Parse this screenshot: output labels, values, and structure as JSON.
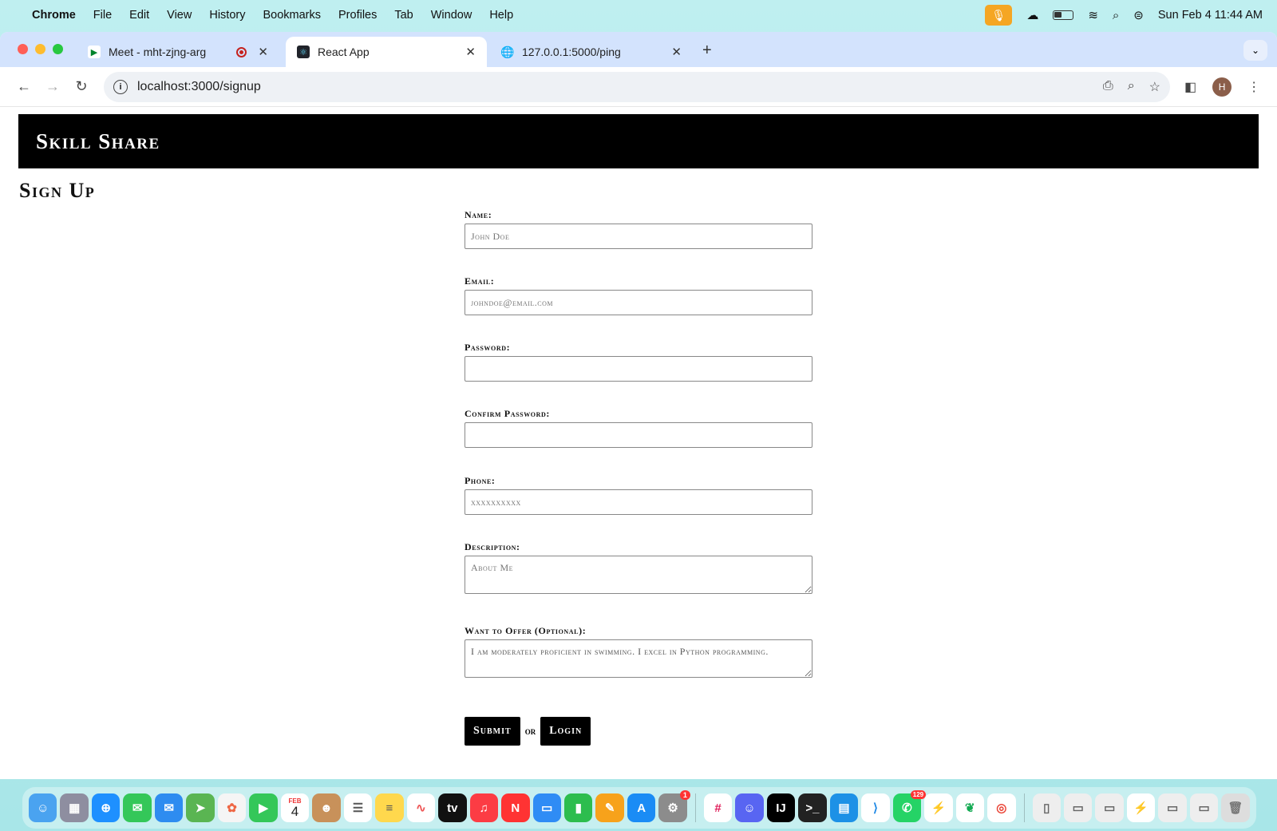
{
  "menubar": {
    "app_name": "Chrome",
    "items": [
      "File",
      "Edit",
      "View",
      "History",
      "Bookmarks",
      "Profiles",
      "Tab",
      "Window",
      "Help"
    ],
    "datetime": "Sun Feb 4  11:44 AM"
  },
  "tabs": [
    {
      "title": "Meet - mht-zjng-arg",
      "icon": "google-meet-icon",
      "recording": true
    },
    {
      "title": "React App",
      "icon": "react-icon",
      "active": true
    },
    {
      "title": "127.0.0.1:5000/ping",
      "icon": "globe-icon"
    }
  ],
  "toolbar": {
    "url": "localhost:3000/signup",
    "avatar_letter": "H"
  },
  "page": {
    "site_title": "Skill Share",
    "page_title": "Sign Up",
    "fields": {
      "name": {
        "label": "Name:",
        "placeholder": "John Doe",
        "value": ""
      },
      "email": {
        "label": "Email:",
        "placeholder": "johndoe@email.com",
        "value": ""
      },
      "password": {
        "label": "Password:",
        "value": ""
      },
      "confirm_password": {
        "label": "Confirm Password:",
        "value": ""
      },
      "phone": {
        "label": "Phone:",
        "placeholder": "xxxxxxxxxx",
        "value": ""
      },
      "description": {
        "label": "Description:",
        "placeholder": "About Me",
        "value": ""
      },
      "offer": {
        "label": "Want to Offer (Optional):",
        "value": "I am moderately proficient in swimming. I excel in Python programming."
      }
    },
    "submit_label": "Submit",
    "or_label": "or",
    "login_label": "Login"
  },
  "dock": {
    "calendar_month": "FEB",
    "calendar_day": "4",
    "whatsapp_badge": "129",
    "settings_badge": "1"
  }
}
